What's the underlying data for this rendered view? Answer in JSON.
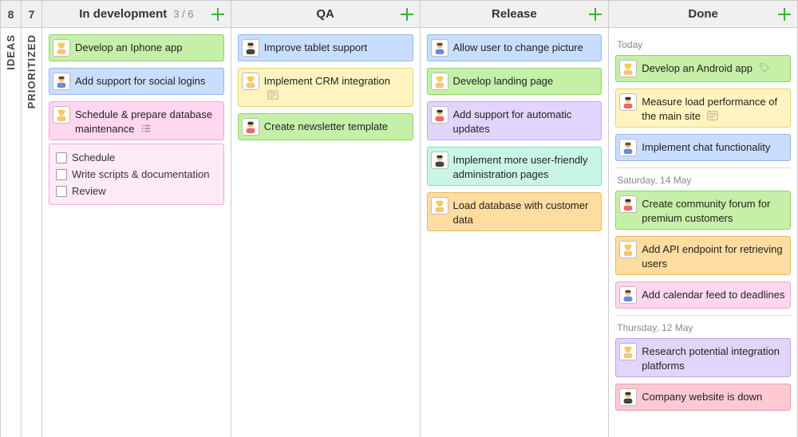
{
  "sidebar": {
    "ideas": {
      "count": "8",
      "label": "IDEAS"
    },
    "prioritized": {
      "count": "7",
      "label": "PRIORITIZED"
    }
  },
  "columns": {
    "in_development": {
      "title": "In development",
      "wip": "3 / 6",
      "cards": [
        {
          "text": "Develop an Iphone app"
        },
        {
          "text": "Add support for social logins"
        },
        {
          "text": "Schedule & prepare database maintenance"
        }
      ],
      "checklist": [
        "Schedule",
        "Write scripts & documentation",
        "Review"
      ]
    },
    "qa": {
      "title": "QA",
      "cards": [
        {
          "text": "Improve tablet support"
        },
        {
          "text": "Implement CRM integration"
        },
        {
          "text": "Create newsletter template"
        }
      ]
    },
    "release": {
      "title": "Release",
      "cards": [
        {
          "text": "Allow user to change picture"
        },
        {
          "text": "Develop landing page"
        },
        {
          "text": "Add support for automatic updates"
        },
        {
          "text": "Implement more user-friendly administration pages"
        },
        {
          "text": "Load database with customer data"
        }
      ]
    },
    "done": {
      "title": "Done",
      "groups": {
        "g0": {
          "label": "Today",
          "cards": [
            {
              "text": "Develop an Android app"
            },
            {
              "text": "Measure load performance of the main site"
            },
            {
              "text": "Implement chat functionality"
            }
          ]
        },
        "g1": {
          "label": "Saturday, 14 May",
          "cards": [
            {
              "text": "Create community forum for premium customers"
            },
            {
              "text": "Add API endpoint for retrieving users"
            },
            {
              "text": "Add calendar feed to deadlines"
            }
          ]
        },
        "g2": {
          "label": "Thursday, 12 May",
          "cards": [
            {
              "text": "Research potential integration platforms"
            },
            {
              "text": "Company website is down"
            }
          ]
        }
      }
    }
  }
}
